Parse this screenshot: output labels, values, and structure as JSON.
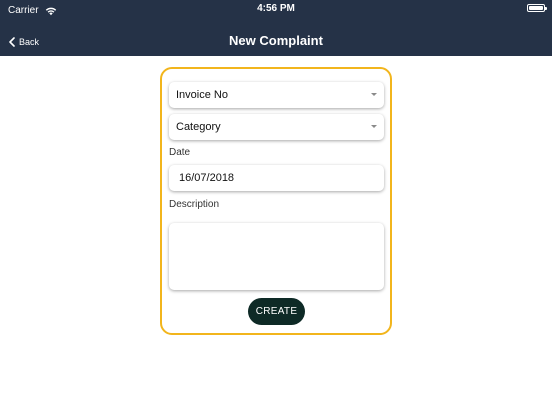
{
  "status_bar": {
    "carrier": "Carrier",
    "time": "4:56 PM",
    "wifi_icon": "wifi-icon",
    "battery_icon": "battery-icon"
  },
  "nav_bar": {
    "back_label": "Back",
    "back_icon": "chevron-left-icon",
    "title": "New Complaint",
    "background_color": "#253247"
  },
  "form": {
    "border_color": "#f2b51c",
    "invoice_dropdown": {
      "selected": "Invoice No"
    },
    "category_dropdown": {
      "selected": "Category"
    },
    "date": {
      "label": "Date",
      "value": "16/07/2018"
    },
    "description": {
      "label": "Description",
      "value": ""
    },
    "create_button": {
      "label": "CREATE",
      "color": "#0e2a26"
    }
  }
}
